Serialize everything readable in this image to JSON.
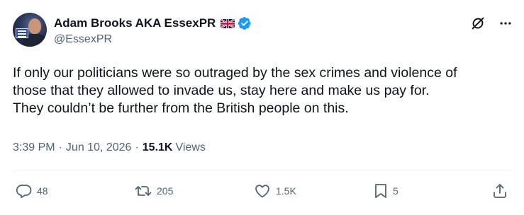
{
  "author": {
    "display_name": "Adam Brooks AKA EssexPR",
    "handle": "@EssexPR",
    "flag_icon": "uk-flag-icon",
    "verified_icon": "verified-badge-icon",
    "verified_color": "#1d9bf0"
  },
  "tweet": {
    "lines": [
      "If only our politicians were so outraged by the sex crimes and violence of",
      "those that they allowed to invade us, stay here and make us pay for.",
      "They couldn’t be further from the British people on this."
    ]
  },
  "meta": {
    "time": "3:39 PM",
    "separator": "·",
    "date": "Jun 10, 2026",
    "views_count": "15.1K",
    "views_label": "Views"
  },
  "top_icons": [
    "grok-icon",
    "more-icon"
  ],
  "actions": {
    "replies": "48",
    "reposts": "205",
    "likes": "1.5K",
    "bookmarks": "5"
  },
  "colors": {
    "text": "#0f1419",
    "secondary": "#536471",
    "divider": "#eff3f4"
  }
}
